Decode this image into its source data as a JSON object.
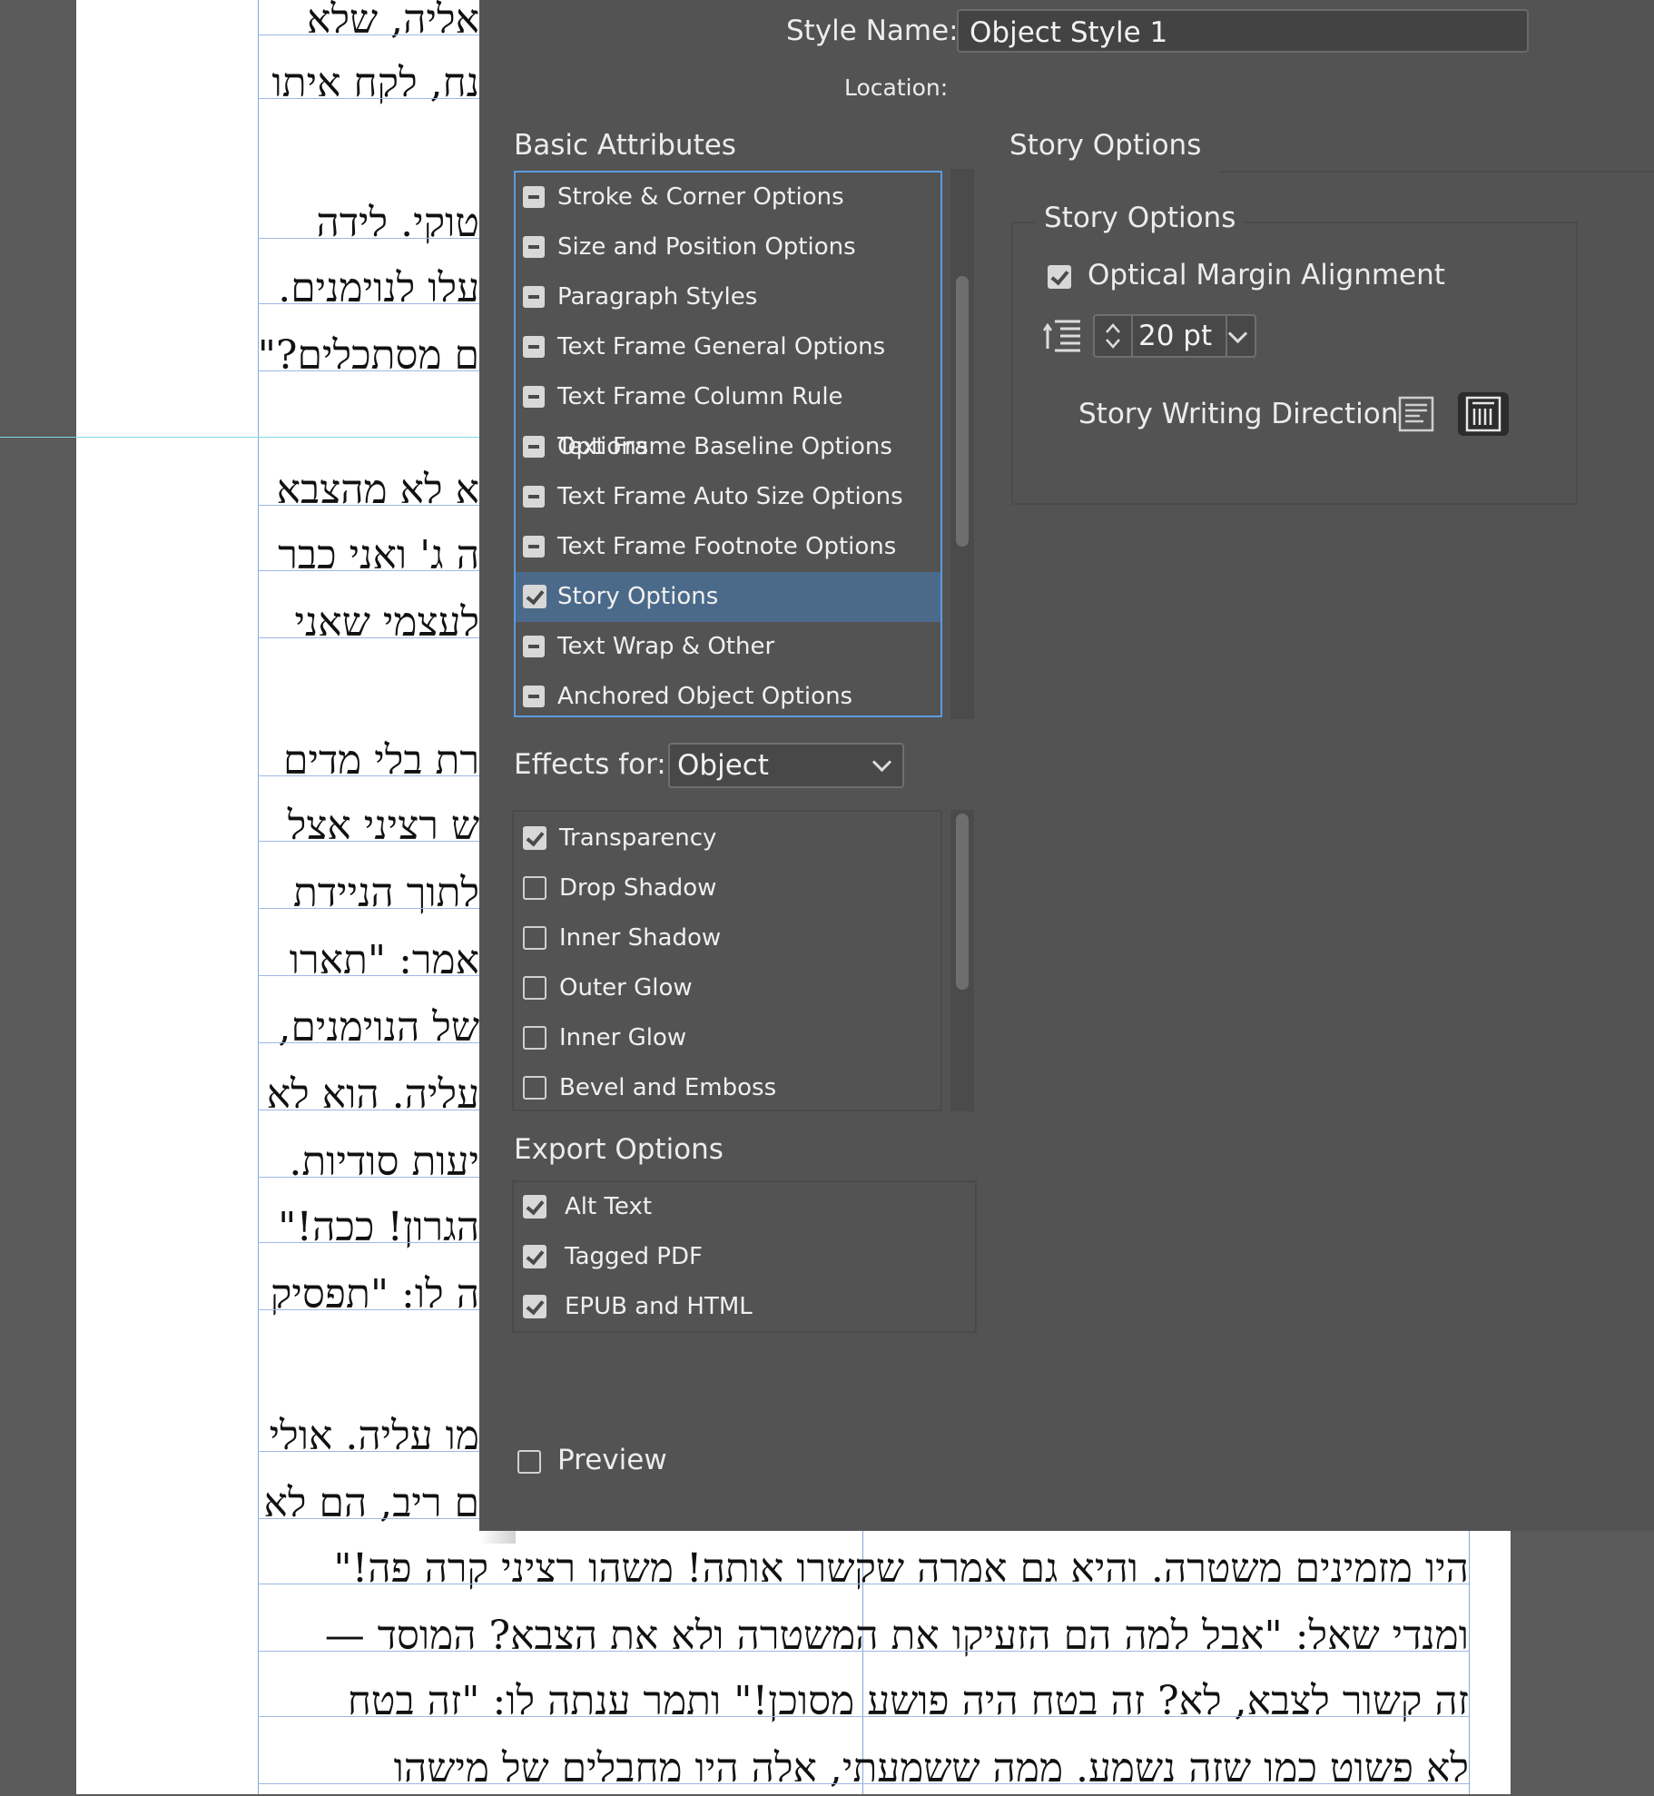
{
  "document": {
    "hebrew_lines": [
      "אליה, שלא",
      "נח, לקח איתו",
      "טוקי. לידה",
      "עלו לנוימנים.",
      "ם מסתכלים?\"",
      "א לא מהצבא",
      "ה ג' ואני כבר",
      "לעצמי שאני",
      "רת בלי מדים",
      "ש רציני אצל",
      "לתוך הניידת",
      "אמר: \"תארו",
      "של הנוימנים,",
      "עליה. הוא לא",
      "יעות סודיות.",
      "הגרון! ככה!\"",
      "ה לו: \"תפסיק",
      "מו עליה. אולי",
      "ם ריב, הם לא",
      "היו מזמינים משטרה. והיא גם אמרה שקשרו אותה! משהו רציני קרה פה!\"",
      "ומנדי שאל: \"אבל למה הם הזעיקו את המשטרה ולא את הצבא? המוסד —",
      "זה קשור לצבא, לא? זה בטח היה פושע מסוכן!\" ותמר ענתה לו: \"זה בטח",
      "לא פשוט כמו שזה נשמע. ממה ששמעתי, אלה היו מחבלים של מישהו"
    ]
  },
  "dialog": {
    "style_name_label": "Style Name:",
    "style_name_value": "Object Style 1",
    "location_label": "Location:",
    "basic_attributes": {
      "title": "Basic Attributes",
      "items": [
        {
          "label": "Stroke & Corner Options",
          "state": "minus"
        },
        {
          "label": "Size and Position Options",
          "state": "minus"
        },
        {
          "label": "Paragraph Styles",
          "state": "minus"
        },
        {
          "label": "Text Frame General Options",
          "state": "minus"
        },
        {
          "label": "Text Frame Column Rule Options",
          "state": "minus"
        },
        {
          "label": "Text Frame Baseline Options",
          "state": "minus"
        },
        {
          "label": "Text Frame Auto Size Options",
          "state": "minus"
        },
        {
          "label": "Text Frame Footnote Options",
          "state": "minus"
        },
        {
          "label": "Story Options",
          "state": "checked",
          "selected": true
        },
        {
          "label": "Text Wrap & Other",
          "state": "minus"
        },
        {
          "label": "Anchored Object Options",
          "state": "minus"
        }
      ]
    },
    "effects": {
      "label": "Effects for:",
      "selected": "Object",
      "items": [
        {
          "label": "Transparency",
          "checked": true
        },
        {
          "label": "Drop Shadow",
          "checked": false
        },
        {
          "label": "Inner Shadow",
          "checked": false
        },
        {
          "label": "Outer Glow",
          "checked": false
        },
        {
          "label": "Inner Glow",
          "checked": false
        },
        {
          "label": "Bevel and Emboss",
          "checked": false
        }
      ]
    },
    "export_options": {
      "title": "Export Options",
      "items": [
        {
          "label": "Alt Text",
          "checked": true
        },
        {
          "label": "Tagged PDF",
          "checked": true
        },
        {
          "label": "EPUB and HTML",
          "checked": true
        }
      ]
    },
    "preview": {
      "label": "Preview",
      "checked": false
    },
    "story_options": {
      "panel_title": "Story Options",
      "group_title": "Story Options",
      "optical_margin_label": "Optical Margin Alignment",
      "optical_margin_checked": true,
      "size_value": "20 pt",
      "writing_direction_label": "Story Writing Direction"
    }
  },
  "colors": {
    "dialog_bg": "#535353",
    "selection": "#4b6a8a",
    "focus_border": "#5c9ae0"
  }
}
